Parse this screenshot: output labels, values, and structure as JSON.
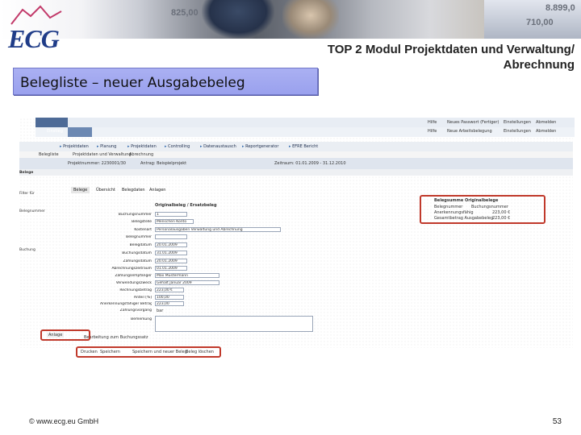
{
  "header": {
    "logo_text": "ECG",
    "photo_numbers": [
      "825,00",
      "710,00",
      "8.899,0"
    ]
  },
  "slide": {
    "section_title": "Belegliste – neuer Ausgabebeleg",
    "top_title_line1": "TOP 2 Modul Projektdaten und Verwaltung/",
    "top_title_line2": "Abrechnung",
    "footer_copyright": "© www.ecg.eu GmbH",
    "page_number": "53"
  },
  "screenshot": {
    "top_links_row1": [
      "Hilfe",
      "Neues Passwort (Fertiger)",
      "Einstellungen",
      "Abmelden"
    ],
    "top_links_row2": [
      "Hilfe",
      "Neue Arbeitsbelegung",
      "Einstellungen",
      "Abmelden"
    ],
    "left_tab": "Einstieg",
    "nav_items": [
      "Projektdaten",
      "Planung",
      "Projektdaten",
      "Controlling",
      "Datenaustausch",
      "Reportgenerator",
      "EFRE Bericht"
    ],
    "sub_nav": [
      "Belegliste",
      "Projektdaten und Verwaltung",
      "Abrechnung"
    ],
    "context_bar": [
      "Projektnummer: 2230001/30",
      "Antrag: Beispielprojekt",
      "Zeitraum: 01.01.2009 - 31.12.2010"
    ],
    "left_labels": [
      "Belege",
      "Filter für",
      "Belegnummer",
      "Buchung"
    ],
    "subtabs": [
      "Belege",
      "Übersicht",
      "Belegdaten",
      "Anlagen"
    ],
    "form_heading": "Originalbeleg / Ersatzbeleg",
    "form_fields": [
      {
        "label": "Buchungsnummer",
        "value": "1"
      },
      {
        "label": "Belegstelle",
        "value": "Menschen Konto"
      },
      {
        "label": "Kostenart",
        "value": "Personalausgaben Verwaltung und Abrechnung"
      },
      {
        "label": "Belegnummer",
        "value": ""
      },
      {
        "label": "Belegdatum",
        "value": "20.01.2009"
      },
      {
        "label": "Buchungsdatum",
        "value": "31.01.2009"
      },
      {
        "label": "Zahlungsdatum",
        "value": "20.01.2009"
      },
      {
        "label": "Abrechnungszeitraum",
        "value": "01.01.2009"
      },
      {
        "label": "Zahlungsempfänger",
        "value": "Max Mustermann"
      },
      {
        "label": "Verwendungszweck",
        "value": "Gehalt Januar 2009"
      },
      {
        "label": "Rechnungsbetrag",
        "value": "223,00 €"
      },
      {
        "label": "Anteil [%]",
        "value": "100,00"
      },
      {
        "label": "Anerkennungsfähiger Betrag",
        "value": "223,00"
      },
      {
        "label": "Zahlungsvorgang",
        "value": "bar"
      }
    ],
    "bemerkung_label": "Bemerkung",
    "bottom_left_button": "Anlage",
    "processing_text": "Bearbeitung zum Buchungssatz",
    "bottom_buttons": [
      "Drucken",
      "Speichern",
      "Speichern und neuer Beleg",
      "Beleg löschen"
    ],
    "summary_title": "Belegsumme Originalbelege",
    "summary_rows": [
      {
        "label": "Belegnummer",
        "value": "Buchungsnummer"
      },
      {
        "label": "Anerkennungsfähig",
        "value": "223,00 €"
      },
      {
        "label": "Gesamtbetrag Ausgabebeleg",
        "value": "223,00 €"
      }
    ]
  },
  "colors": {
    "title_box": "#9aa1ee",
    "highlight": "#c0392b",
    "logo_blue": "#1f3c88"
  }
}
